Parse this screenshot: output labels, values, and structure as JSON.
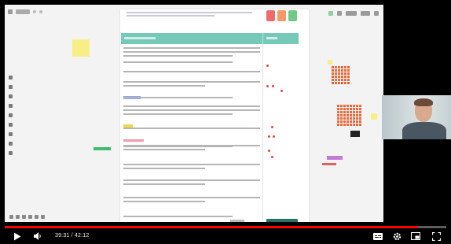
{
  "player": {
    "time_display": "39:31 / 42:12",
    "progress_fraction": 0.936,
    "colors": {
      "played": "#ff0000",
      "track": "#5e5e5e",
      "background": "#000000"
    },
    "icons": {
      "play": "play-icon",
      "volume": "volume-icon",
      "subtitles": "subtitles-icon",
      "settings": "gear-icon",
      "miniplayer": "miniplayer-icon",
      "fullscreen": "fullscreen-icon"
    }
  },
  "board": {
    "accent_colors": {
      "table_header": "#75c9b8",
      "highlight_blue": "#8fa7f2",
      "highlight_yellow": "#f0d84e",
      "marker_red": "#e04646"
    }
  }
}
